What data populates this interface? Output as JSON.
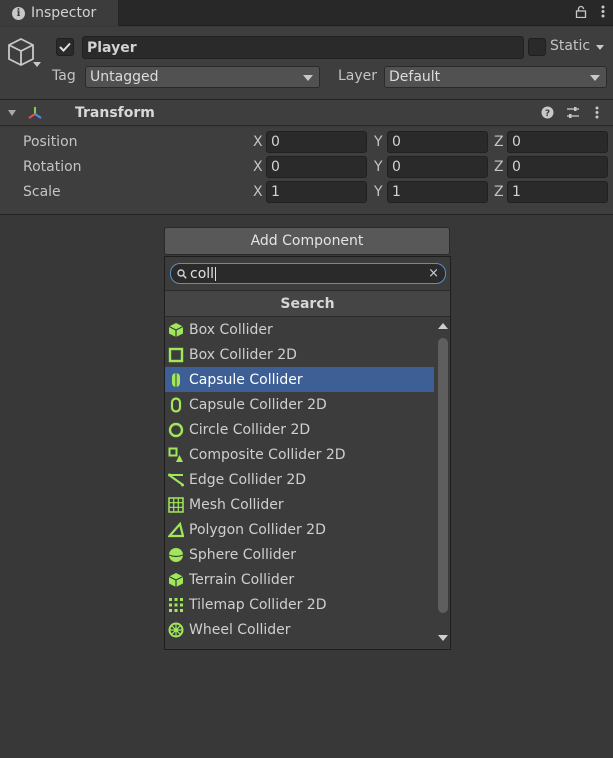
{
  "tab": {
    "title": "Inspector",
    "icon": "info-icon"
  },
  "gameobject": {
    "active": true,
    "name": "Player",
    "static_label": "Static",
    "static_checked": false,
    "tag_label": "Tag",
    "tag_value": "Untagged",
    "layer_label": "Layer",
    "layer_value": "Default"
  },
  "transform": {
    "title": "Transform",
    "rows": [
      {
        "label": "Position",
        "x": "0",
        "y": "0",
        "z": "0"
      },
      {
        "label": "Rotation",
        "x": "0",
        "y": "0",
        "z": "0"
      },
      {
        "label": "Scale",
        "x": "1",
        "y": "1",
        "z": "1"
      }
    ],
    "axis_labels": {
      "x": "X",
      "y": "Y",
      "z": "Z"
    }
  },
  "add_component": {
    "button_label": "Add Component",
    "search_value": "coll",
    "search_header": "Search",
    "items": [
      {
        "label": "Box Collider",
        "icon": "box-collider-icon"
      },
      {
        "label": "Box Collider 2D",
        "icon": "box-collider-2d-icon"
      },
      {
        "label": "Capsule Collider",
        "icon": "capsule-collider-icon",
        "selected": true
      },
      {
        "label": "Capsule Collider 2D",
        "icon": "capsule-collider-2d-icon"
      },
      {
        "label": "Circle Collider 2D",
        "icon": "circle-collider-2d-icon"
      },
      {
        "label": "Composite Collider 2D",
        "icon": "composite-collider-2d-icon"
      },
      {
        "label": "Edge Collider 2D",
        "icon": "edge-collider-2d-icon"
      },
      {
        "label": "Mesh Collider",
        "icon": "mesh-collider-icon"
      },
      {
        "label": "Polygon Collider 2D",
        "icon": "polygon-collider-2d-icon"
      },
      {
        "label": "Sphere Collider",
        "icon": "sphere-collider-icon"
      },
      {
        "label": "Terrain Collider",
        "icon": "terrain-collider-icon"
      },
      {
        "label": "Tilemap Collider 2D",
        "icon": "tilemap-collider-2d-icon"
      },
      {
        "label": "Wheel Collider",
        "icon": "wheel-collider-icon"
      }
    ]
  },
  "colors": {
    "accent_green": "#a0e85a",
    "selection": "#3e5f96",
    "background": "#383838"
  }
}
